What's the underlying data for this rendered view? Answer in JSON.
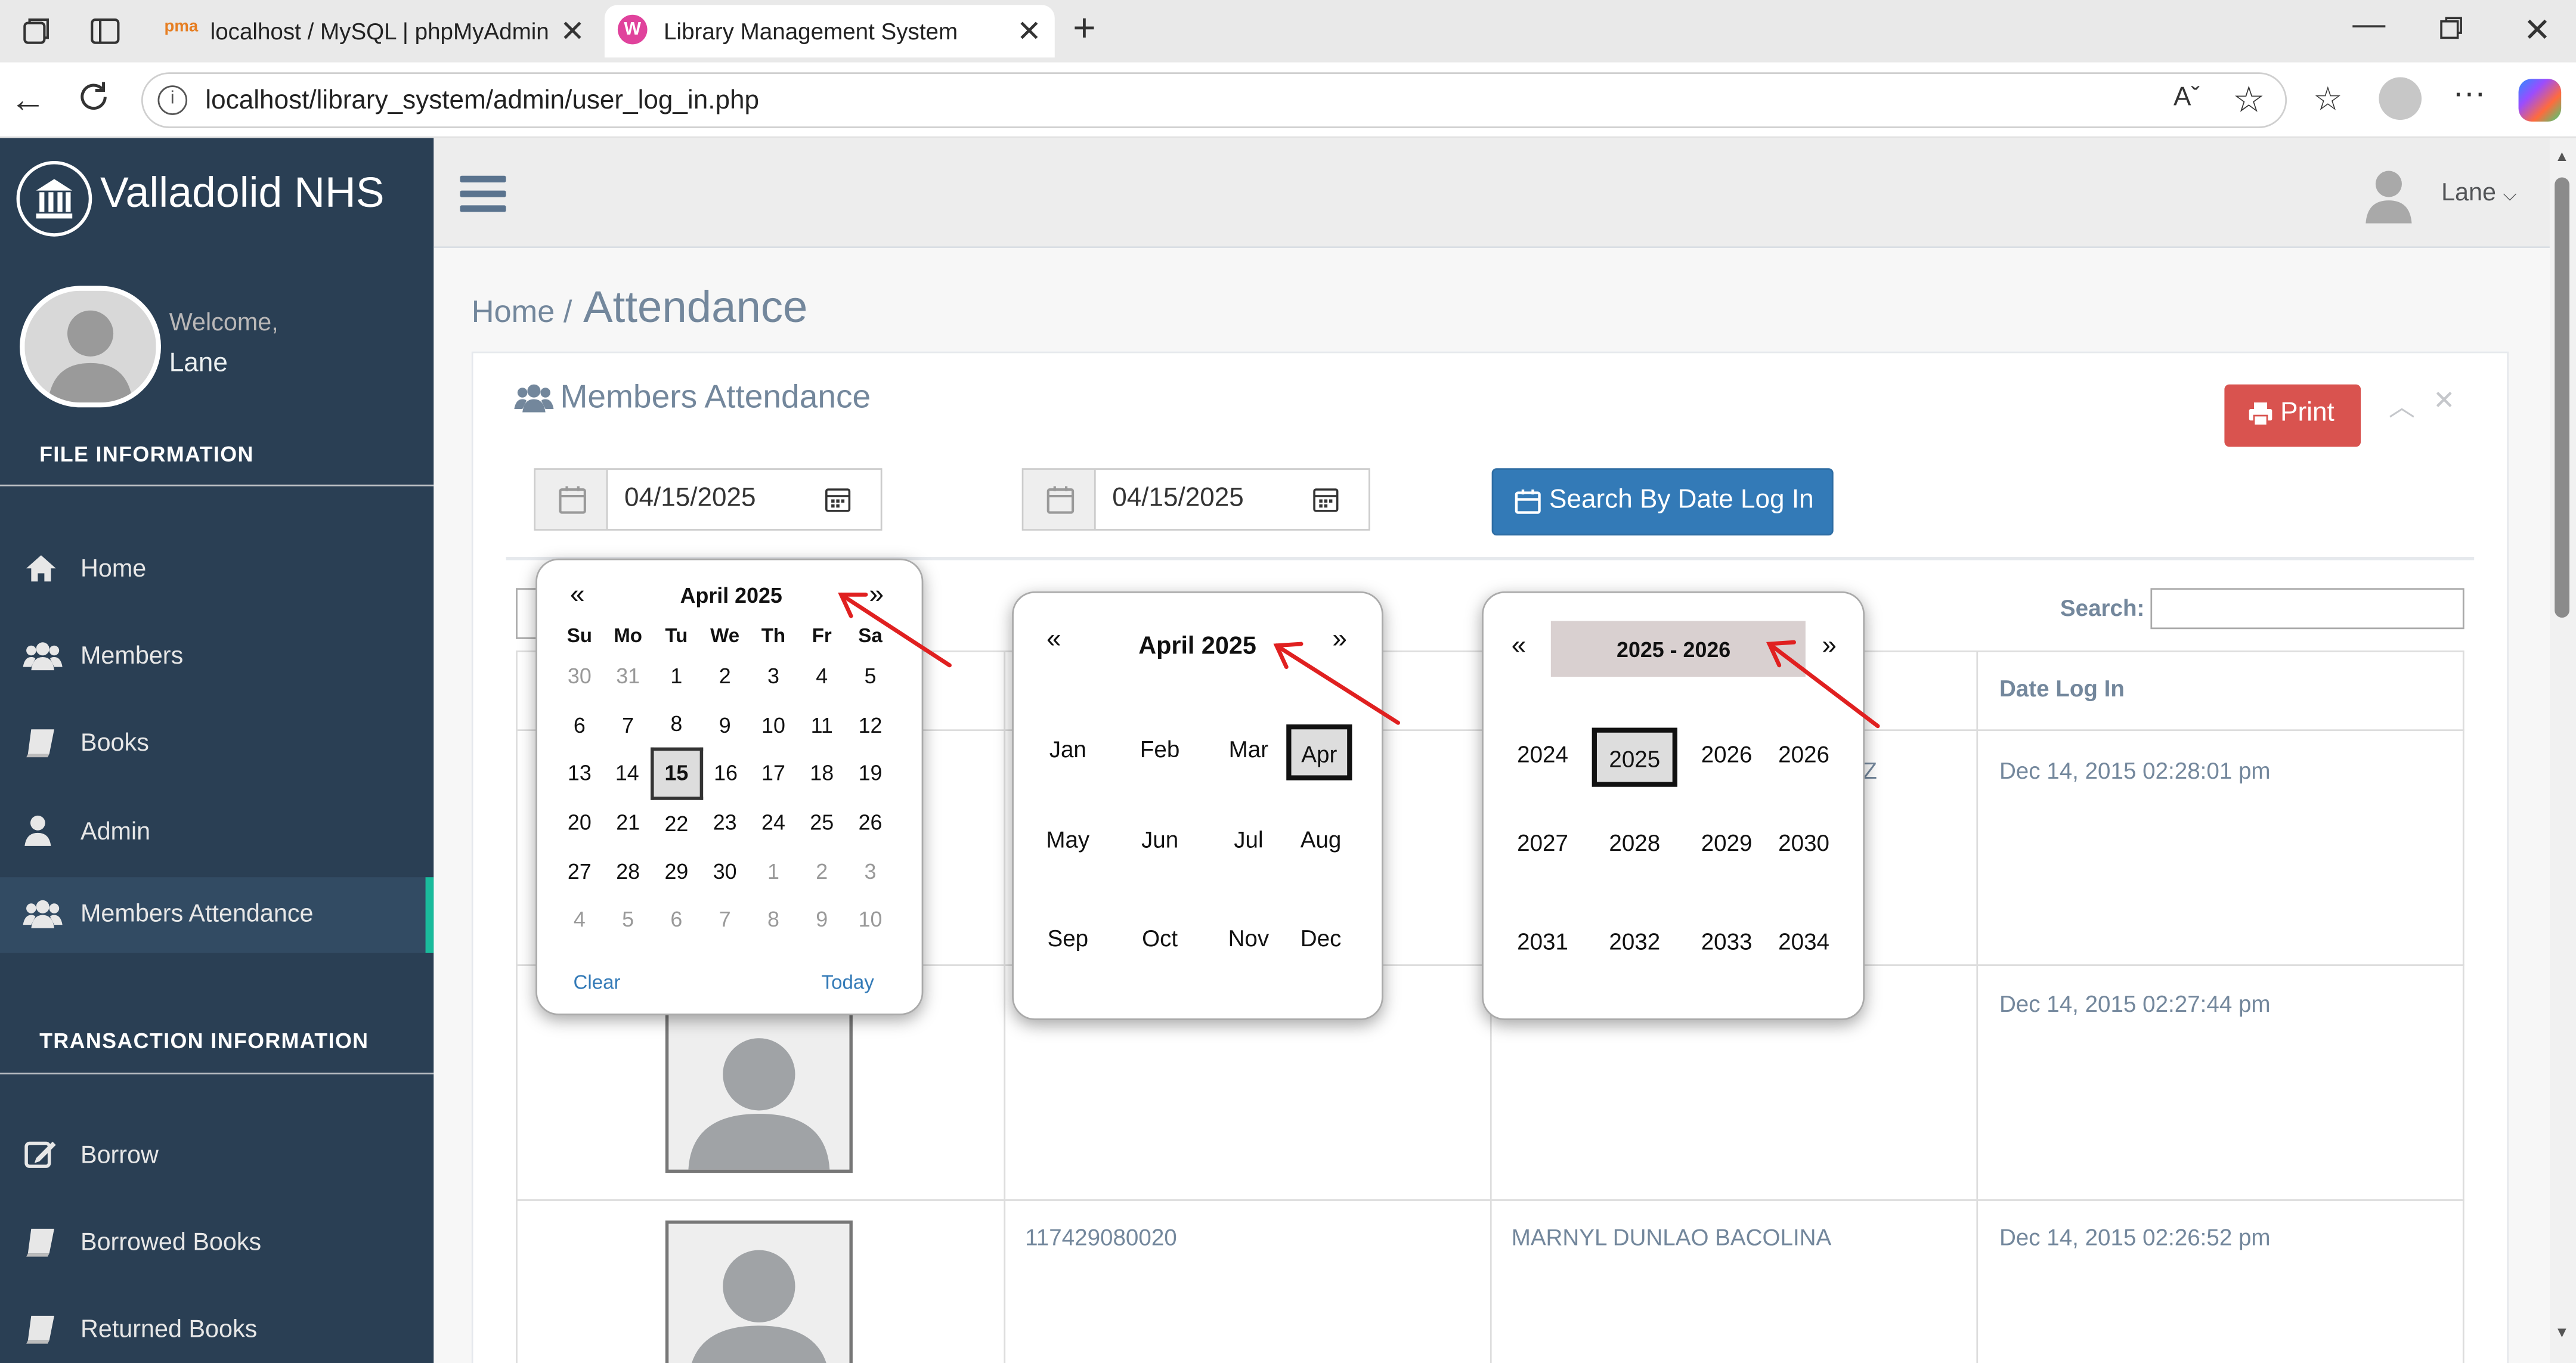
{
  "browser": {
    "tabs": [
      {
        "title": "localhost / MySQL | phpMyAdmin"
      },
      {
        "title": "Library Management System"
      }
    ],
    "url": "localhost/library_system/admin/user_log_in.php"
  },
  "sidebar": {
    "brand": "Valladolid NHS",
    "welcome": "Welcome,",
    "username": "Lane",
    "section1": "FILE INFORMATION",
    "items1": [
      {
        "label": "Home",
        "icon": "home-icon"
      },
      {
        "label": "Members",
        "icon": "users-icon"
      },
      {
        "label": "Books",
        "icon": "book-icon"
      },
      {
        "label": "Admin",
        "icon": "user-icon"
      },
      {
        "label": "Members Attendance",
        "icon": "users-icon"
      }
    ],
    "section2": "TRANSACTION INFORMATION",
    "items2": [
      {
        "label": "Borrow",
        "icon": "edit-icon"
      },
      {
        "label": "Borrowed Books",
        "icon": "book-icon"
      },
      {
        "label": "Returned Books",
        "icon": "book-icon"
      }
    ]
  },
  "topnav": {
    "user": "Lane"
  },
  "breadcrumb": {
    "home": "Home /",
    "current": "Attendance"
  },
  "panel": {
    "title": "Members Attendance",
    "print": "Print",
    "date_from": "04/15/2025",
    "date_to": "04/15/2025",
    "search_button": "Search By Date Log In",
    "search_label": "Search:",
    "search_value": ""
  },
  "table": {
    "header_date": "Date Log In",
    "rows": [
      {
        "id": "",
        "name": "Z",
        "date": "Dec 14, 2015 02:28:01 pm"
      },
      {
        "id": "",
        "name": "",
        "date": "Dec 14, 2015 02:27:44 pm"
      },
      {
        "id": "117429080020",
        "name": "MARNYL DUNLAO BACOLINA",
        "date": "Dec 14, 2015 02:26:52 pm"
      }
    ]
  },
  "calendar_days": {
    "prev": "«",
    "next": "»",
    "title": "April 2025",
    "weekdays": [
      "Su",
      "Mo",
      "Tu",
      "We",
      "Th",
      "Fr",
      "Sa"
    ],
    "weeks": [
      [
        "30",
        "31",
        "1",
        "2",
        "3",
        "4",
        "5"
      ],
      [
        "6",
        "7",
        "8",
        "9",
        "10",
        "11",
        "12"
      ],
      [
        "13",
        "14",
        "15",
        "16",
        "17",
        "18",
        "19"
      ],
      [
        "20",
        "21",
        "22",
        "23",
        "24",
        "25",
        "26"
      ],
      [
        "27",
        "28",
        "29",
        "30",
        "1",
        "2",
        "3"
      ],
      [
        "4",
        "5",
        "6",
        "7",
        "8",
        "9",
        "10"
      ]
    ],
    "selected": "15",
    "clear": "Clear",
    "today": "Today"
  },
  "calendar_months": {
    "prev": "«",
    "next": "»",
    "title": "April 2025",
    "months": [
      "Jan",
      "Feb",
      "Mar",
      "Apr",
      "May",
      "Jun",
      "Jul",
      "Aug",
      "Sep",
      "Oct",
      "Nov",
      "Dec"
    ],
    "selected": "Apr"
  },
  "calendar_years": {
    "prev": "«",
    "next": "»",
    "title": "2025 - 2026",
    "years": [
      "2024",
      "2025",
      "2026",
      "2026",
      "2027",
      "2028",
      "2029",
      "2030",
      "2031",
      "2032",
      "2033",
      "2034"
    ],
    "selected": "2025"
  },
  "colors": {
    "sidebar": "#2a3f54",
    "accent": "#1abb9c",
    "print_button": "#d9534f",
    "search_button": "#337ab7",
    "annotation_arrow": "#e02020"
  }
}
